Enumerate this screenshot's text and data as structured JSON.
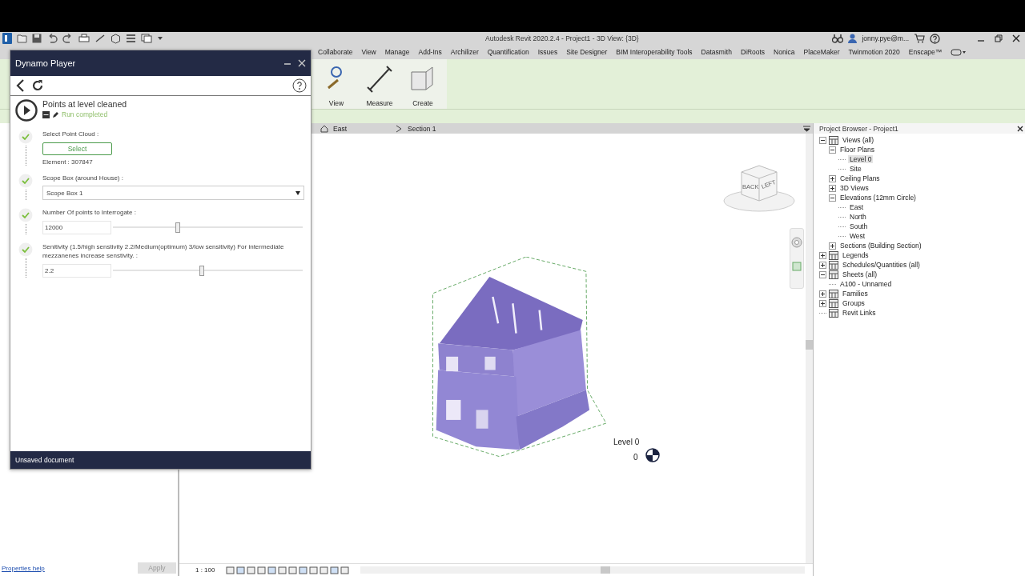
{
  "title_bar": {
    "title": "Autodesk Revit 2020.2.4 - Project1 - 3D View: {3D}",
    "user": "jonny.pye@m..."
  },
  "ribbon_tabs": [
    "Collaborate",
    "View",
    "Manage",
    "Add-Ins",
    "Archilizer",
    "Quantification",
    "Issues",
    "Site Designer",
    "BIM Interoperability Tools",
    "Datasmith",
    "DiRoots",
    "Nonica",
    "PlaceMaker",
    "Twinmotion 2020",
    "Enscape™"
  ],
  "ribbon_panels": [
    "View",
    "Measure",
    "Create"
  ],
  "view_tabs": [
    "East",
    "Section 1"
  ],
  "dynamo_player": {
    "title": "Dynamo Player",
    "script": {
      "name": "Points at level cleaned",
      "status": "Run completed"
    },
    "inputs": [
      {
        "kind": "select",
        "label": "Select Point Cloud :",
        "button": "Select",
        "detail": "Element : 307847",
        "done": true
      },
      {
        "kind": "dropdown",
        "label": "Scope Box (around House) :",
        "value": "Scope Box 1",
        "done": true
      },
      {
        "kind": "slider",
        "label": "Number Of points to Interrogate :",
        "value": "12000",
        "level": 0.34,
        "done": true
      },
      {
        "kind": "slider",
        "label": "Senitivity (1.5/high senstivity 2.2/Medium(optimum) 3/low sensitivity) For intermediate mezzanenes increase senstivity. :",
        "value": "2.2",
        "level": 0.47,
        "done": true
      }
    ],
    "footer": "Unsaved document"
  },
  "viewport": {
    "level_label": "Level 0",
    "level_value": "0",
    "view_cube": [
      "BACK",
      "LEFT"
    ]
  },
  "project_browser": {
    "title": "Project Browser - Project1",
    "tree": [
      {
        "label": "Views (all)",
        "expanded": true,
        "children": [
          {
            "label": "Floor Plans",
            "expanded": true,
            "children": [
              {
                "label": "Level 0",
                "selected": true
              },
              {
                "label": "Site",
                "selected": false
              }
            ]
          },
          {
            "label": "Ceiling Plans",
            "expanded": false
          },
          {
            "label": "3D Views",
            "expanded": false
          },
          {
            "label": "Elevations (12mm Circle)",
            "expanded": true,
            "children": [
              {
                "label": "East",
                "selected": false
              },
              {
                "label": "North",
                "selected": false
              },
              {
                "label": "South",
                "selected": false
              },
              {
                "label": "West",
                "selected": false
              }
            ]
          },
          {
            "label": "Sections (Building Section)",
            "expanded": false
          }
        ]
      },
      {
        "label": "Legends",
        "expanded": false
      },
      {
        "label": "Schedules/Quantities (all)",
        "expanded": false
      },
      {
        "label": "Sheets (all)",
        "expanded": true,
        "children": [
          {
            "label": "A100 - Unnamed",
            "selected": false
          }
        ]
      },
      {
        "label": "Families",
        "expanded": false
      },
      {
        "label": "Groups",
        "expanded": false
      },
      {
        "label": "Revit Links"
      }
    ]
  },
  "properties": {
    "help_link": "Properties help",
    "apply_button": {
      "label": "Apply",
      "disabled": true
    }
  },
  "status_bar": {
    "scale": "1 : 100"
  }
}
